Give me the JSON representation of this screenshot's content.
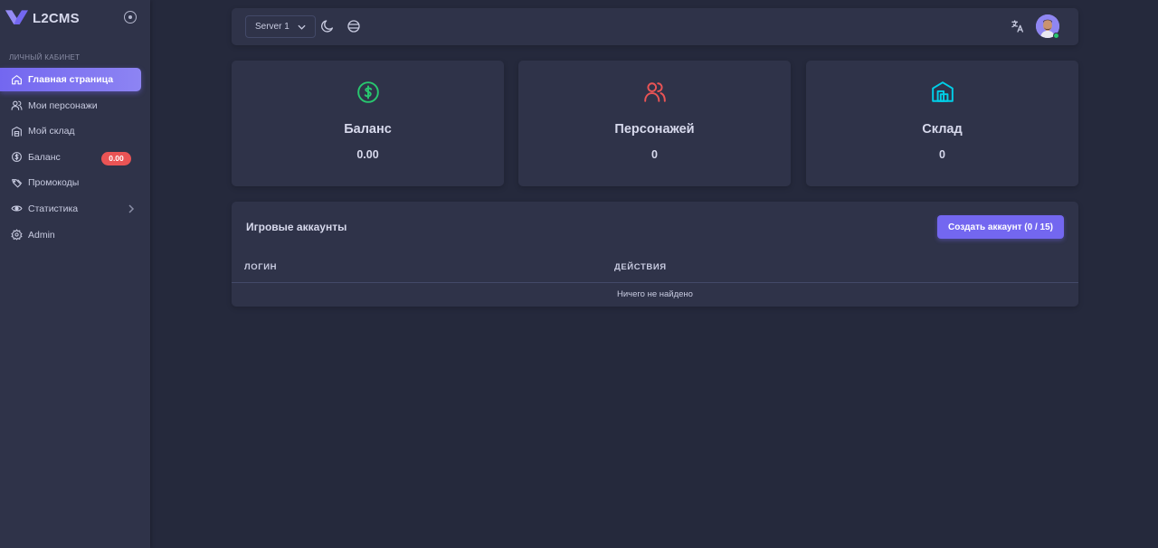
{
  "brand": {
    "name": "L2CMS"
  },
  "sidebar": {
    "section_header": "ЛИЧНЫЙ КАБИНЕТ",
    "items": [
      {
        "label": "Главная страница",
        "icon": "home-icon",
        "active": true
      },
      {
        "label": "Мои персонажи",
        "icon": "users-icon"
      },
      {
        "label": "Мой склад",
        "icon": "warehouse-icon"
      },
      {
        "label": "Баланс",
        "icon": "dollar-icon",
        "badge": "0.00"
      },
      {
        "label": "Промокоды",
        "icon": "tags-icon"
      },
      {
        "label": "Статистика",
        "icon": "eye-icon",
        "has_submenu": true
      },
      {
        "label": "Admin",
        "icon": "gear-icon"
      }
    ]
  },
  "navbar": {
    "server_select": "Server 1"
  },
  "cards": [
    {
      "title": "Баланс",
      "value": "0.00",
      "icon": "dollar-circle-icon",
      "color": "#28c76f"
    },
    {
      "title": "Персонажей",
      "value": "0",
      "icon": "users-icon",
      "color": "#ea5455"
    },
    {
      "title": "Склад",
      "value": "0",
      "icon": "warehouse-icon",
      "color": "#00cfe8"
    }
  ],
  "accounts": {
    "title": "Игровые аккаунты",
    "create_button": "Создать аккаунт (0 / 15)",
    "columns": [
      "ЛОГИН",
      "ДЕЙСТВИЯ"
    ],
    "empty_text": "Ничего не найдено"
  },
  "colors": {
    "accent": "#7367f0",
    "danger": "#ea5455",
    "success": "#28c76f",
    "info": "#00cfe8"
  }
}
